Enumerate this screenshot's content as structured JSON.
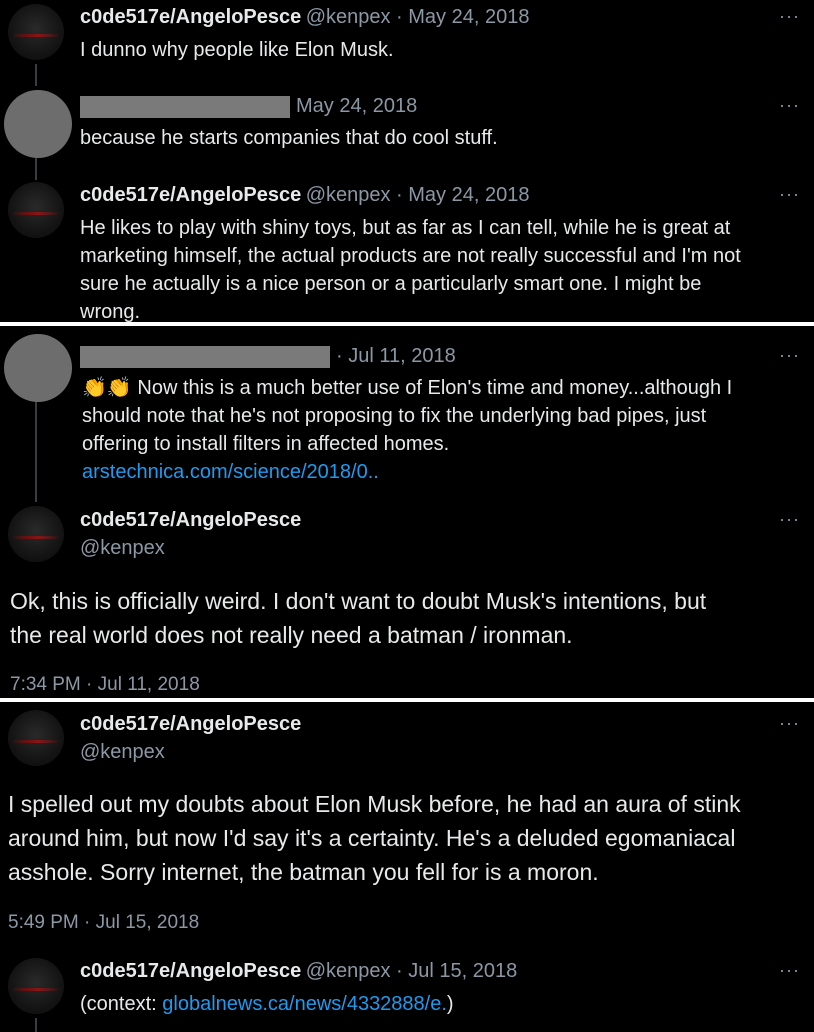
{
  "more_icon": "···",
  "tweets": [
    {
      "name": "c0de517e/AngeloPesce",
      "handle_date": "@kenpex · May 24, 2018",
      "text": "I dunno why people like Elon Musk."
    },
    {
      "date": "May 24, 2018",
      "text": "because he starts companies that do cool stuff."
    },
    {
      "name": "c0de517e/AngeloPesce",
      "handle_date": "@kenpex · May 24, 2018",
      "lines": [
        "He likes to play with shiny toys, but as far as I can tell, while he is great at",
        "marketing himself, the actual products are not really successful and I'm not",
        "sure he actually is a nice person or a particularly smart one. I might be",
        "wrong."
      ]
    },
    {
      "date": "· Jul 11, 2018",
      "emoji": "👏👏",
      "lines": [
        "Now this is a much better use of Elon's time and money...although I",
        "should note that he's not proposing to fix the underlying bad pipes, just",
        "offering to install filters in affected homes."
      ],
      "link": "arstechnica.com/science/2018/0.."
    },
    {
      "name": "c0de517e/AngeloPesce",
      "handle": "@kenpex",
      "lines": [
        "Ok, this is officially weird. I don't want to doubt Musk's intentions, but",
        "the real world does not really need a batman / ironman."
      ],
      "timestamp": "7:34 PM · Jul 11, 2018"
    },
    {
      "name": "c0de517e/AngeloPesce",
      "handle": "@kenpex",
      "lines": [
        "I spelled out my doubts about Elon Musk before, he had an aura of stink",
        "around him, but now I'd say it's a certainty. He's a deluded egomaniacal",
        "asshole. Sorry internet, the batman you fell for is a moron."
      ],
      "timestamp": "5:49 PM · Jul 15, 2018"
    },
    {
      "name": "c0de517e/AngeloPesce",
      "handle_date": "@kenpex · Jul 15, 2018",
      "prefix": "(context: ",
      "link": "globalnews.ca/news/4332888/e.",
      "suffix": ")"
    }
  ]
}
